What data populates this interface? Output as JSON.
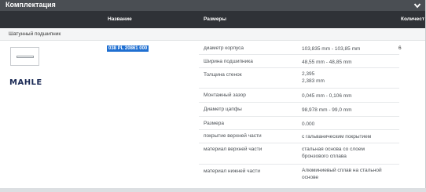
{
  "section": {
    "title": "Комплектация"
  },
  "table": {
    "headers": {
      "name": "Название",
      "sizes": "Размеры",
      "qty": "Количест"
    },
    "group_label": "Шатунный подшипник"
  },
  "part": {
    "brand": "MAHLE",
    "number": "038 PL 20861 000",
    "quantity": "6"
  },
  "specs": [
    {
      "label": "диаметр корпуса",
      "value": "103,835 mm - 103,85 mm"
    },
    {
      "label": "Ширина подшипника",
      "value": "48,55 mm - 48,85 mm"
    },
    {
      "label": "Толщина стенок",
      "value": "2,395",
      "value2": "2,383 mm"
    },
    {
      "label": "Монтажный зазор",
      "value": "0,045 mm - 0,106 mm"
    },
    {
      "label": "Диаметр цапфы",
      "value": "98,978 mm - 99,0 mm"
    },
    {
      "label": "Размера",
      "value": "0.000"
    },
    {
      "label": "покрытие верхней части",
      "value": "с гальваническим покрытием"
    },
    {
      "label": "материал верхней части",
      "value": "стальная основа со слоем",
      "value2": "бронзового сплава"
    },
    {
      "label": "материал нижней части",
      "value": "Алюминиевый сплав на стальной",
      "value2": "основе"
    }
  ],
  "icons": {
    "collapse": "chevron-down-icon"
  },
  "colors": {
    "title_bar": "#4a4e53",
    "header_bar": "#2f3237",
    "selection": "#1f6fd1",
    "brand": "#1b2a55"
  }
}
